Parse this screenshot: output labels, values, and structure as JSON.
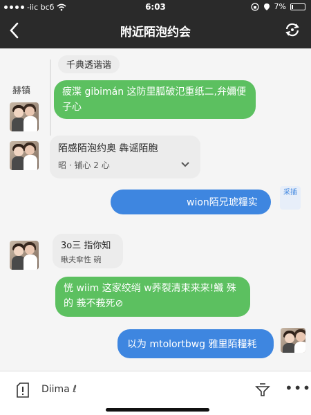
{
  "status_bar": {
    "carrier": "-iic bcб",
    "time": "6:03",
    "battery": "7%",
    "battery_level": 0.07
  },
  "nav": {
    "title": "附近陌泡约会"
  },
  "chat": {
    "top_chip": "千典透谐谐",
    "sender_name": "赫镇",
    "messages": [
      {
        "text": "疲渫 gibimán 这防里胍破氾重纸二,弁嬭便子心"
      },
      {
        "text": "陌感陌泡约奥 犇谣陌胞",
        "subtext": "昭 · 铺心 2 心"
      },
      {
        "text": "wion陌兄琥糧实"
      },
      {
        "text": "3o三 指你知",
        "subtext": "瞅夫傘性 碗"
      },
      {
        "text": "恍 wiim 这家绞绡 w荞裂清束来来!鱵 殊的 莪不莪死⊘"
      },
      {
        "text": "以为 mtolortbwg 雅里陌糧耗"
      }
    ],
    "side_badge": "采插"
  },
  "bottom_bar": {
    "input_value": "Diima ℓ"
  },
  "icons": {
    "back": "chevron-left-icon",
    "refresh": "refresh-icon",
    "info": "info-icon",
    "filter": "filter-icon",
    "more": "more-icon",
    "wifi": "wifi-icon",
    "battery": "battery-icon"
  },
  "colors": {
    "topbar": "#2a2a2a",
    "green_bubble": "#5cc060",
    "blue_bubble": "#3e86e0",
    "grey_bubble": "#ececec"
  }
}
